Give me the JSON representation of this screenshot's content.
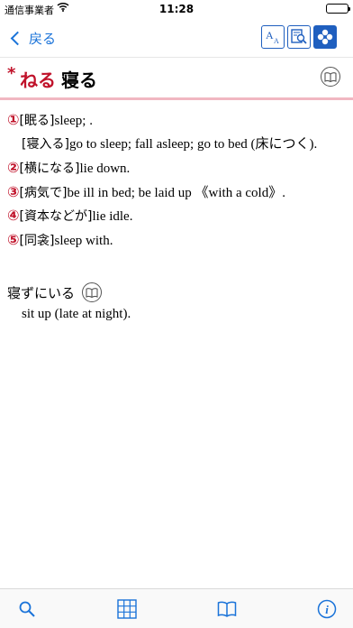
{
  "status_bar": {
    "carrier": "通信事業者",
    "time": "11:28"
  },
  "nav": {
    "back_label": "戻る",
    "tools": [
      "text-size-icon",
      "search-doc-icon",
      "flower-icon"
    ],
    "accent_color": "#1f5fbf"
  },
  "entry": {
    "marker": "*",
    "reading": "ねる",
    "kanji": "寝る",
    "highlight_color": "#c0122a",
    "senses": [
      {
        "num": "①",
        "jp": "[眠る]",
        "en": "sleep; ."
      },
      {
        "num": "",
        "jp": "[寝入る]",
        "en": "go to sleep; fall asleep; go to bed (床につく)."
      },
      {
        "num": "②",
        "jp": "[横になる]",
        "en": "lie down."
      },
      {
        "num": "③",
        "jp": "[病気で]",
        "en": "be ill in bed; be laid up 《with a cold》."
      },
      {
        "num": "④",
        "jp": "[資本などが]",
        "en": "lie idle."
      },
      {
        "num": "⑤",
        "jp": "[同衾]",
        "en": "sleep with."
      }
    ],
    "phrase": {
      "jp": "寝ずにいる",
      "en": "sit up (late at night)."
    }
  },
  "tabbar": {
    "tabs": [
      "search-icon",
      "grid-icon",
      "book-icon",
      "info-icon"
    ]
  }
}
